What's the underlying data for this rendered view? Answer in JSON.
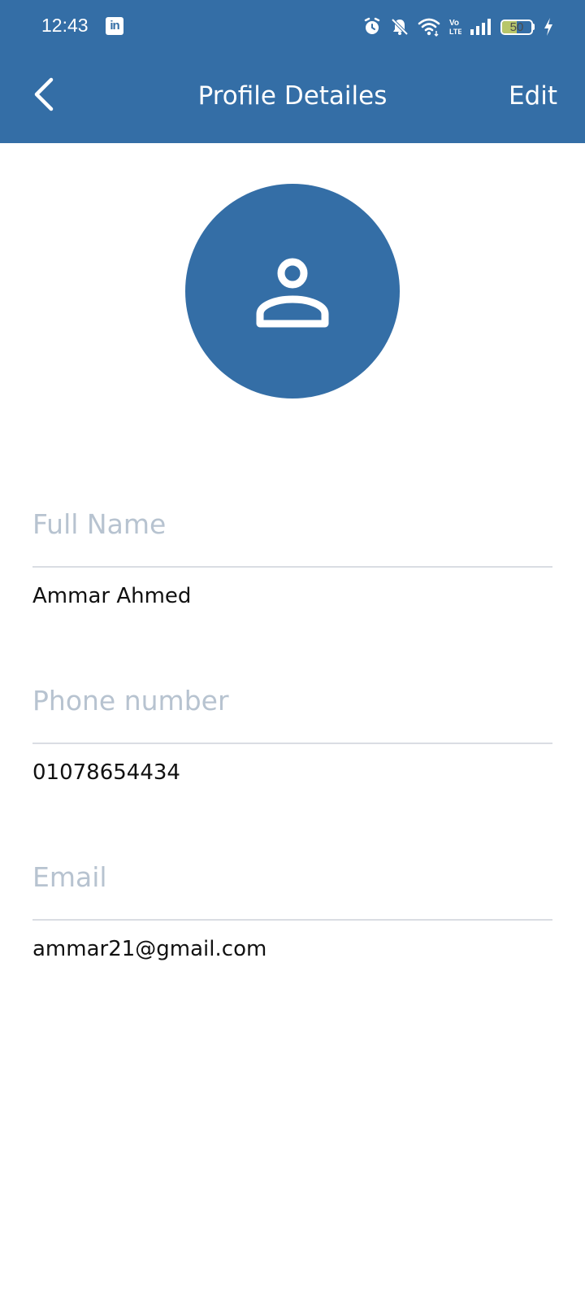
{
  "status_bar": {
    "time": "12:43",
    "notification_icon": "linkedin-icon",
    "icons": [
      "alarm-icon",
      "muted-bell-icon",
      "wifi-icon",
      "volte-icon",
      "signal-icon",
      "battery-icon",
      "charging-icon"
    ],
    "battery_level": "50",
    "battery_fill_percent": 50
  },
  "app_bar": {
    "title": "Profile Detailes",
    "edit_label": "Edit",
    "background": "#346ea6"
  },
  "avatar": {
    "icon": "person-icon",
    "color": "#346ea6"
  },
  "fields": [
    {
      "label": "Full Name",
      "value": "Ammar Ahmed"
    },
    {
      "label": "Phone number",
      "value": "01078654434"
    },
    {
      "label": "Email",
      "value": "ammar21@gmail.com"
    }
  ]
}
